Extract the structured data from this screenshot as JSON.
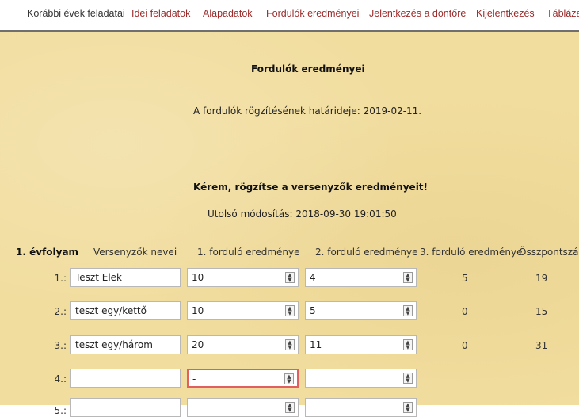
{
  "nav": {
    "items": [
      "Korábbi évek feladatai",
      "Idei feladatok",
      "Alapadatok",
      "Fordulók eredményei",
      "Jelentkezés a döntőre",
      "Kijelentkezés",
      "Táblázat"
    ]
  },
  "page": {
    "title": "Fordulók eredményei",
    "deadline": "A fordulók rögzítésének határideje: 2019-02-11.",
    "request": "Kérem, rögzítse a versenyzők eredményeit!",
    "last_modified": "Utolsó módosítás: 2018-09-30 19:01:50"
  },
  "table": {
    "grade_label": "1. évfolyam",
    "headers": [
      "Versenyzők nevei",
      "1. forduló eredménye",
      "2. forduló eredménye",
      "3. forduló eredménye",
      "Összpontszám"
    ],
    "rows": [
      {
        "num": "1.:",
        "name": "Teszt Elek",
        "r1": "10",
        "r2": "4",
        "r3": "5",
        "total": "19"
      },
      {
        "num": "2.:",
        "name": "teszt egy/kettő",
        "r1": "10",
        "r2": "5",
        "r3": "0",
        "total": "15"
      },
      {
        "num": "3.:",
        "name": "teszt egy/három",
        "r1": "20",
        "r2": "11",
        "r3": "0",
        "total": "31"
      },
      {
        "num": "4.:",
        "name": "",
        "r1": "-",
        "r2": "",
        "r3": "",
        "total": ""
      },
      {
        "num": "5.:",
        "name": "",
        "r1": "",
        "r2": "",
        "r3": "",
        "total": ""
      }
    ]
  },
  "colors": {
    "background": "#f1dd9e",
    "nav_link": "#9b2b2b",
    "invalid_border": "#e06060"
  }
}
